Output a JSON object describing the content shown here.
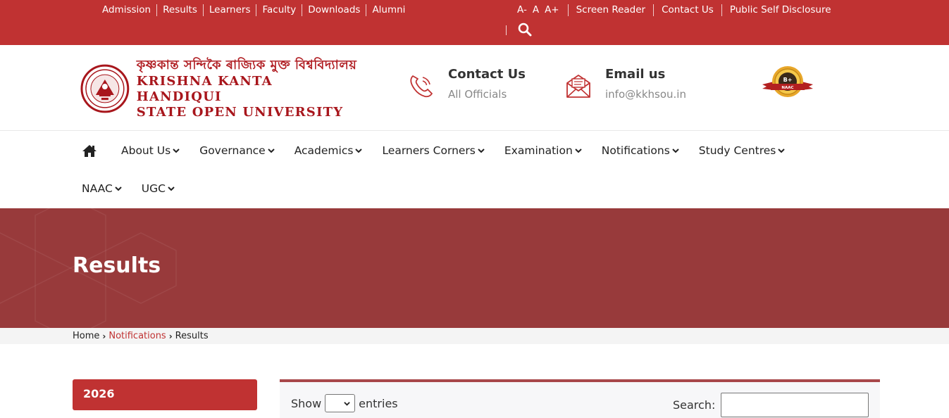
{
  "topbar": {
    "links": [
      "Admission",
      "Results",
      "Learners",
      "Faculty",
      "Downloads",
      "Alumni"
    ],
    "font_sizes": [
      "A-",
      "A",
      "A+"
    ],
    "right_links": [
      "Screen Reader",
      "Contact Us",
      "Public Self Disclosure"
    ],
    "search_icon": "search-icon",
    "bg_color": "#c03232"
  },
  "header": {
    "logo_assamese": "কৃষ্ণকান্ত সন্দিকৈ ৰাজ্যিক মুক্ত বিশ্ববিদ্যালয়",
    "logo_line1": "KRISHNA KANTA HANDIQUI",
    "logo_line2": "STATE OPEN UNIVERSITY",
    "contact": {
      "title": "Contact Us",
      "subtitle": "All Officials",
      "icon": "phone-icon"
    },
    "email": {
      "title": "Email us",
      "subtitle": "info@kkhsou.in",
      "icon": "envelope-icon"
    },
    "naac_badge": {
      "grade": "B+",
      "label": "NAAC"
    }
  },
  "nav": {
    "home_icon": "home-icon",
    "row1": [
      "About Us",
      "Governance",
      "Academics",
      "Learners Corners",
      "Examination",
      "Notifications",
      "Study Centres"
    ],
    "row2": [
      "NAAC",
      "UGC"
    ]
  },
  "banner": {
    "title": "Results",
    "bg_color": "#983a3b"
  },
  "breadcrumb": {
    "home": "Home",
    "notifications": "Notifications",
    "current": "Results"
  },
  "sidebar": {
    "year": "2026"
  },
  "table": {
    "show_label": "Show",
    "entries_label": "entries",
    "search_label": "Search:",
    "search_value": ""
  }
}
